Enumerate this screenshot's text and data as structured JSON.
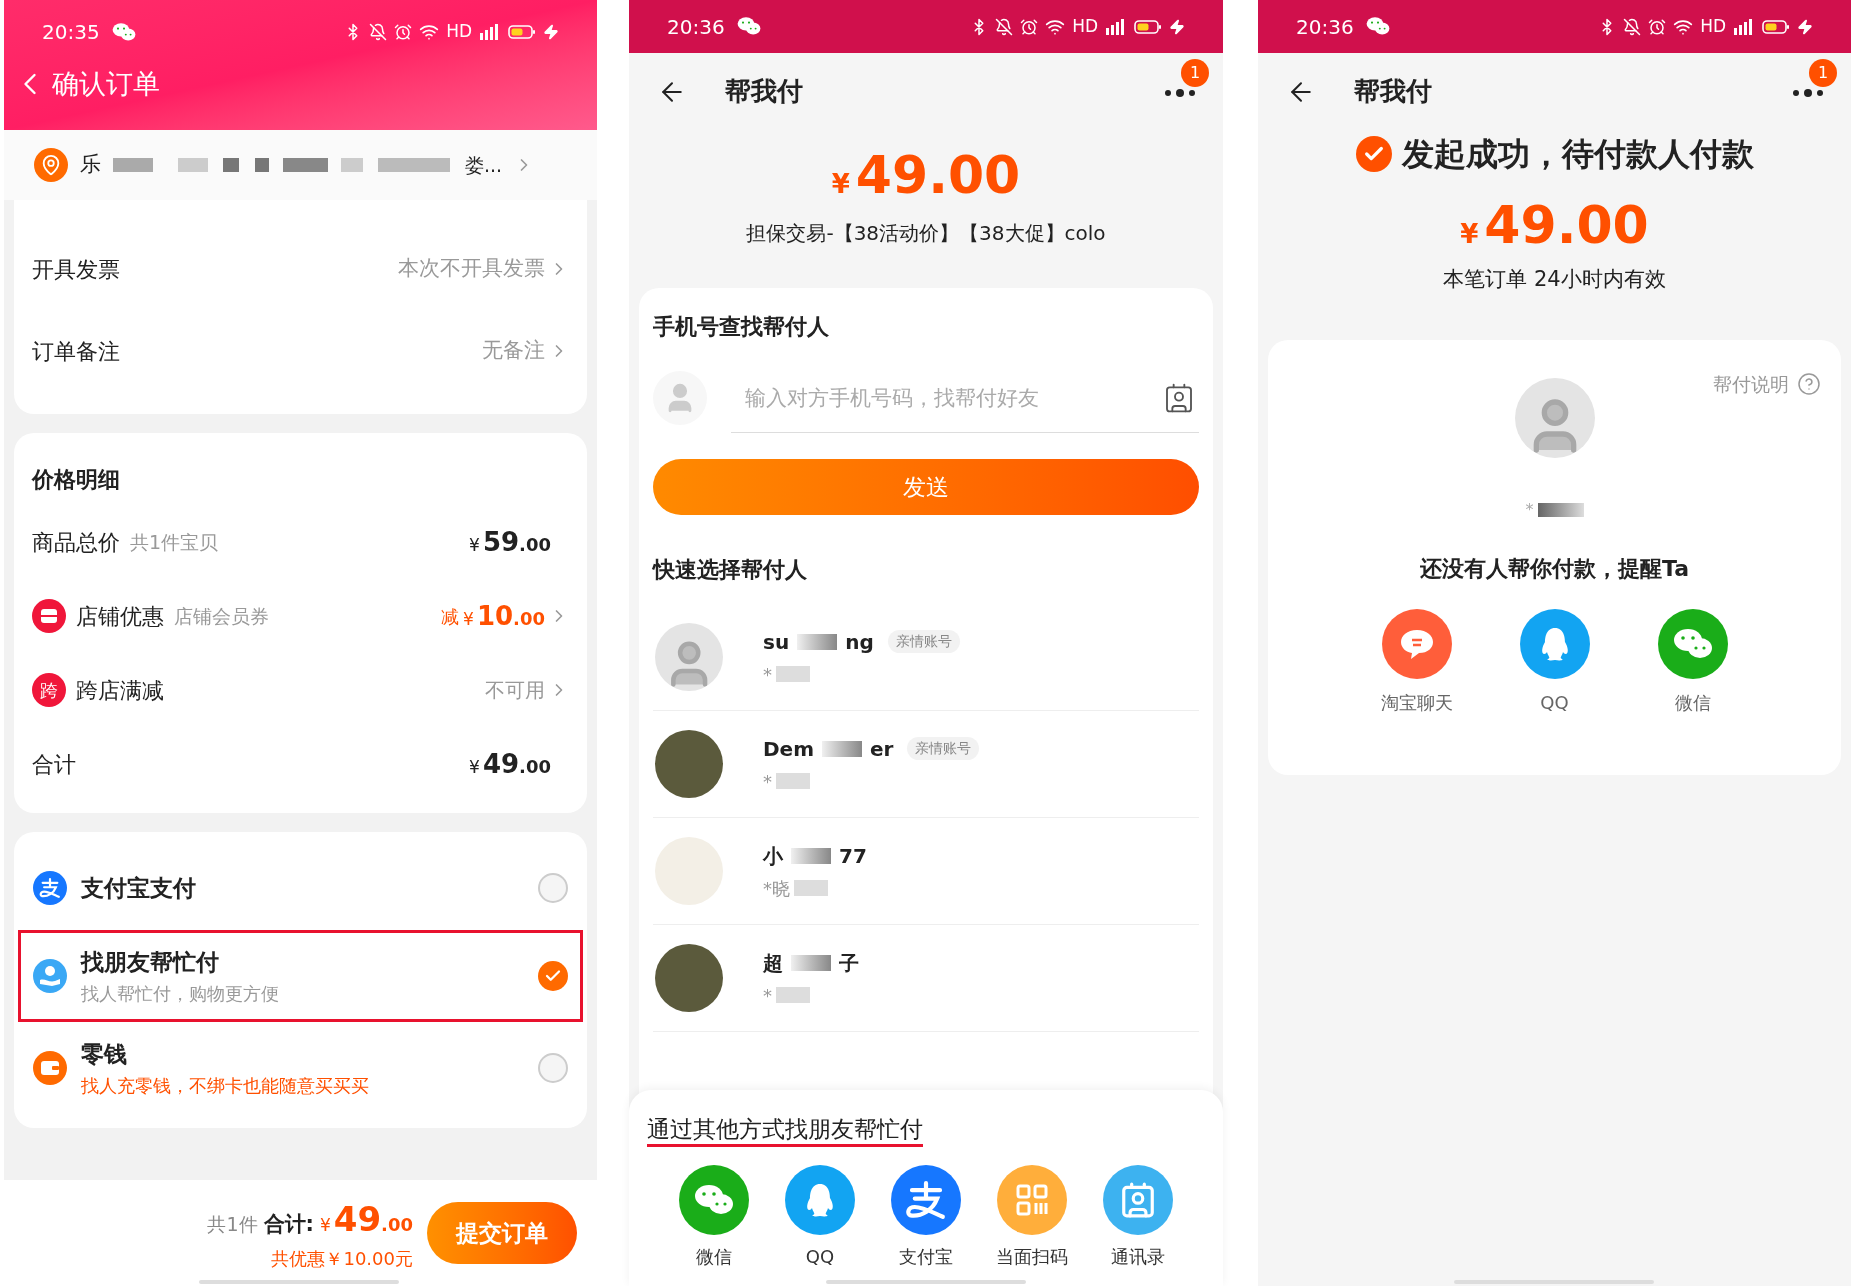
{
  "order_screen": {
    "status_bar": {
      "time": "20:35",
      "network": "HD"
    },
    "title": "确认订单",
    "address": {
      "start": "乐",
      "end": "娄..."
    },
    "options": [
      {
        "label": "开具发票",
        "value": "本次不开具发票"
      },
      {
        "label": "订单备注",
        "value": "无备注"
      }
    ],
    "price_details": {
      "title": "价格明细",
      "rows": [
        {
          "kind": "amount",
          "label": "商品总价",
          "note": "共1件宝贝",
          "currency": "¥",
          "amount_int": "59",
          "amount_dec": ".00"
        },
        {
          "kind": "discount",
          "label": "店铺优惠",
          "note": "店铺会员券",
          "prefix": "减",
          "currency": "¥",
          "amount_int": "10",
          "amount_dec": ".00"
        },
        {
          "kind": "link",
          "icon_text": "跨",
          "label": "跨店满减",
          "value": "不可用"
        },
        {
          "kind": "amount",
          "label": "合计",
          "currency": "¥",
          "amount_int": "49",
          "amount_dec": ".00"
        }
      ]
    },
    "payment_methods": [
      {
        "label": "支付宝支付",
        "selected": false,
        "annotated": false
      },
      {
        "label": "找朋友帮忙付",
        "note": "找人帮忙付，购物更方便",
        "selected": true,
        "annotated": true
      },
      {
        "label": "零钱",
        "note": "找人充零钱，不绑卡也能随意买买买",
        "selected": false,
        "annotated": false
      }
    ],
    "footer": {
      "count": "共1件",
      "total_label": "合计:",
      "currency": "¥",
      "amount_int": "49",
      "amount_dec": ".00",
      "discount": "共优惠￥10.00元",
      "submit": "提交订单"
    }
  },
  "pay_request_screen": {
    "status_bar": {
      "time": "20:36",
      "network": "HD"
    },
    "title": "帮我付",
    "badge": "1",
    "currency": "¥",
    "amount": "49.00",
    "description": "担保交易-【38活动价】【38大促】colo",
    "phone_search": {
      "title": "手机号查找帮付人",
      "placeholder": "输入对方手机号码，找帮付好友",
      "button": "发送"
    },
    "quick_title": "快速选择帮付人",
    "contacts": [
      {
        "name_start": "su",
        "name_end": "ng",
        "tag": "亲情账号",
        "account": "*"
      },
      {
        "name_start": "Dem",
        "name_end": "er",
        "tag": "亲情账号",
        "account": "*"
      },
      {
        "name_start": "小",
        "name_end": "77",
        "account": "*晓"
      },
      {
        "name_start": "超",
        "name_end": "子",
        "account": "*"
      }
    ],
    "share_sheet": {
      "title": "通过其他方式找朋友帮忙付",
      "underlined": true,
      "targets": [
        {
          "label": "微信"
        },
        {
          "label": "QQ"
        },
        {
          "label": "支付宝"
        },
        {
          "label": "当面扫码"
        },
        {
          "label": "通讯录"
        }
      ]
    }
  },
  "success_screen": {
    "status_bar": {
      "time": "20:36",
      "network": "HD"
    },
    "title": "帮我付",
    "badge": "1",
    "status": "发起成功，待付款人付款",
    "currency": "¥",
    "amount": "49.00",
    "validity": "本笔订单 24小时内有效",
    "help": "帮付说明",
    "payer_name": "*",
    "reminder": "还没有人帮你付款，提醒Ta",
    "targets": [
      {
        "label": "淘宝聊天"
      },
      {
        "label": "QQ"
      },
      {
        "label": "微信"
      }
    ]
  }
}
